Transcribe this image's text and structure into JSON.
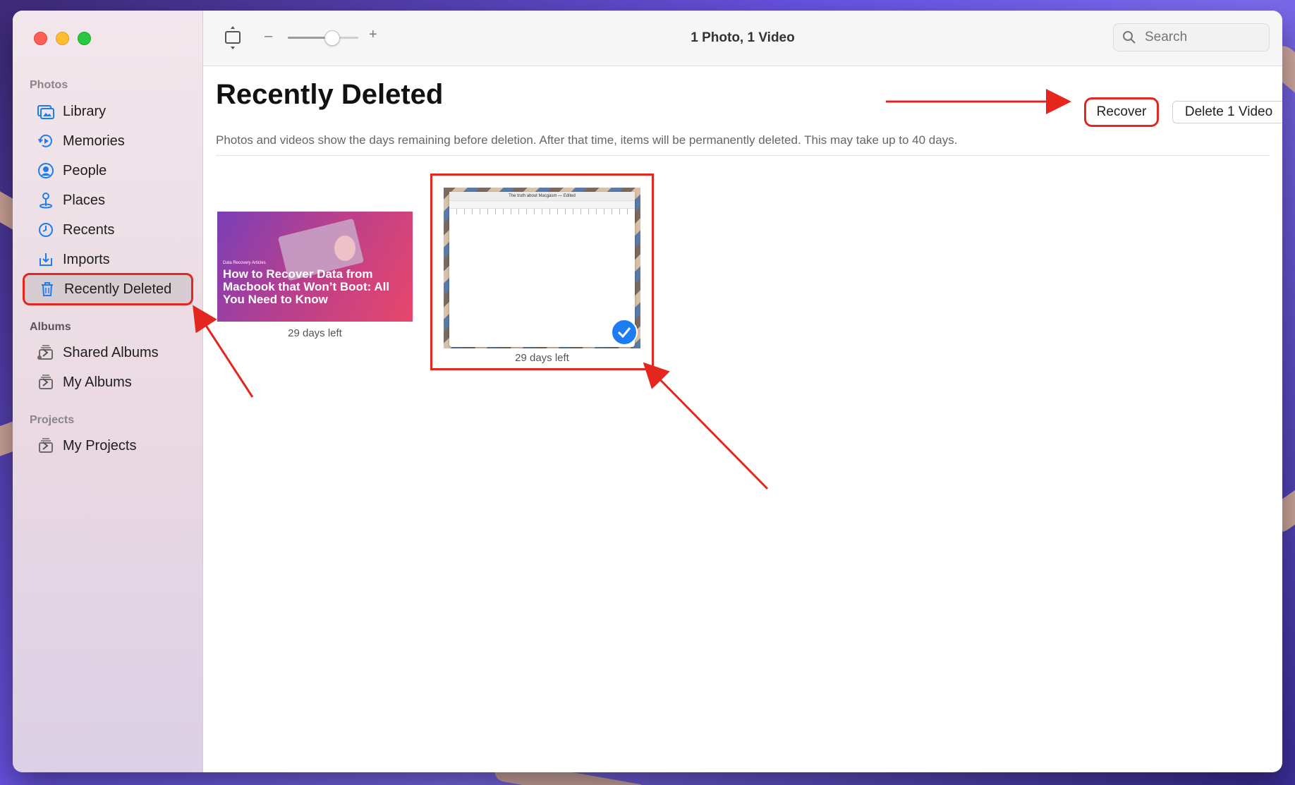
{
  "toolbar": {
    "title": "1 Photo, 1 Video",
    "search_placeholder": "Search",
    "zoom_minus": "–",
    "zoom_plus": "+",
    "zoom_level": 0.62
  },
  "sidebar": {
    "photos_header": "Photos",
    "items": [
      {
        "label": "Library",
        "icon": "library-icon"
      },
      {
        "label": "Memories",
        "icon": "memories-icon"
      },
      {
        "label": "People",
        "icon": "people-icon"
      },
      {
        "label": "Places",
        "icon": "places-icon"
      },
      {
        "label": "Recents",
        "icon": "recents-icon"
      },
      {
        "label": "Imports",
        "icon": "imports-icon"
      },
      {
        "label": "Recently Deleted",
        "icon": "trash-icon"
      }
    ],
    "albums_header": "Albums",
    "albums": [
      {
        "label": "Shared Albums"
      },
      {
        "label": "My Albums"
      }
    ],
    "projects_header": "Projects",
    "projects": [
      {
        "label": "My Projects"
      }
    ]
  },
  "main": {
    "title": "Recently Deleted",
    "subtitle": "Photos and videos show the days remaining before deletion. After that time, items will be permanently deleted. This may take up to 40 days.",
    "recover_label": "Recover",
    "delete_label": "Delete 1 Video",
    "items": [
      {
        "type": "photo",
        "kicker": "Data Recovery Articles",
        "headline": "How to Recover Data from Macbook that Won’t Boot: All You Need to Know",
        "caption": "29 days left",
        "selected": false
      },
      {
        "type": "video",
        "window_title": "The truth about Macgasm — Edited",
        "caption": "29 days left",
        "selected": true
      }
    ]
  },
  "colors": {
    "accent": "#1d7cf2",
    "annotation": "#e5261f"
  }
}
